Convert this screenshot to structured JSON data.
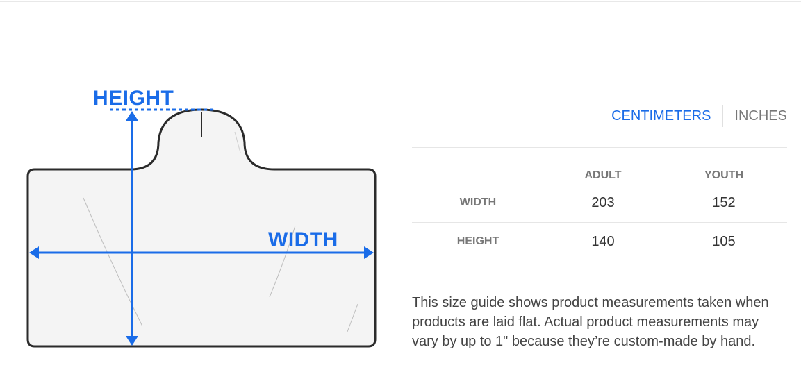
{
  "diagram": {
    "height_label": "HEIGHT",
    "width_label": "WIDTH"
  },
  "units": {
    "selected": "CENTIMETERS",
    "options": [
      "CENTIMETERS",
      "INCHES"
    ]
  },
  "size_table": {
    "columns": [
      "ADULT",
      "YOUTH"
    ],
    "rows": [
      {
        "label": "WIDTH",
        "values": [
          "203",
          "152"
        ]
      },
      {
        "label": "HEIGHT",
        "values": [
          "140",
          "105"
        ]
      }
    ]
  },
  "note": "This size guide shows product measurements taken when products are laid flat. Actual product measurements may vary by up to 1\" because they’re custom-made by hand.",
  "colors": {
    "accent": "#1a6ce8",
    "outline": "#2b2b2b",
    "fill": "#f4f4f4"
  }
}
